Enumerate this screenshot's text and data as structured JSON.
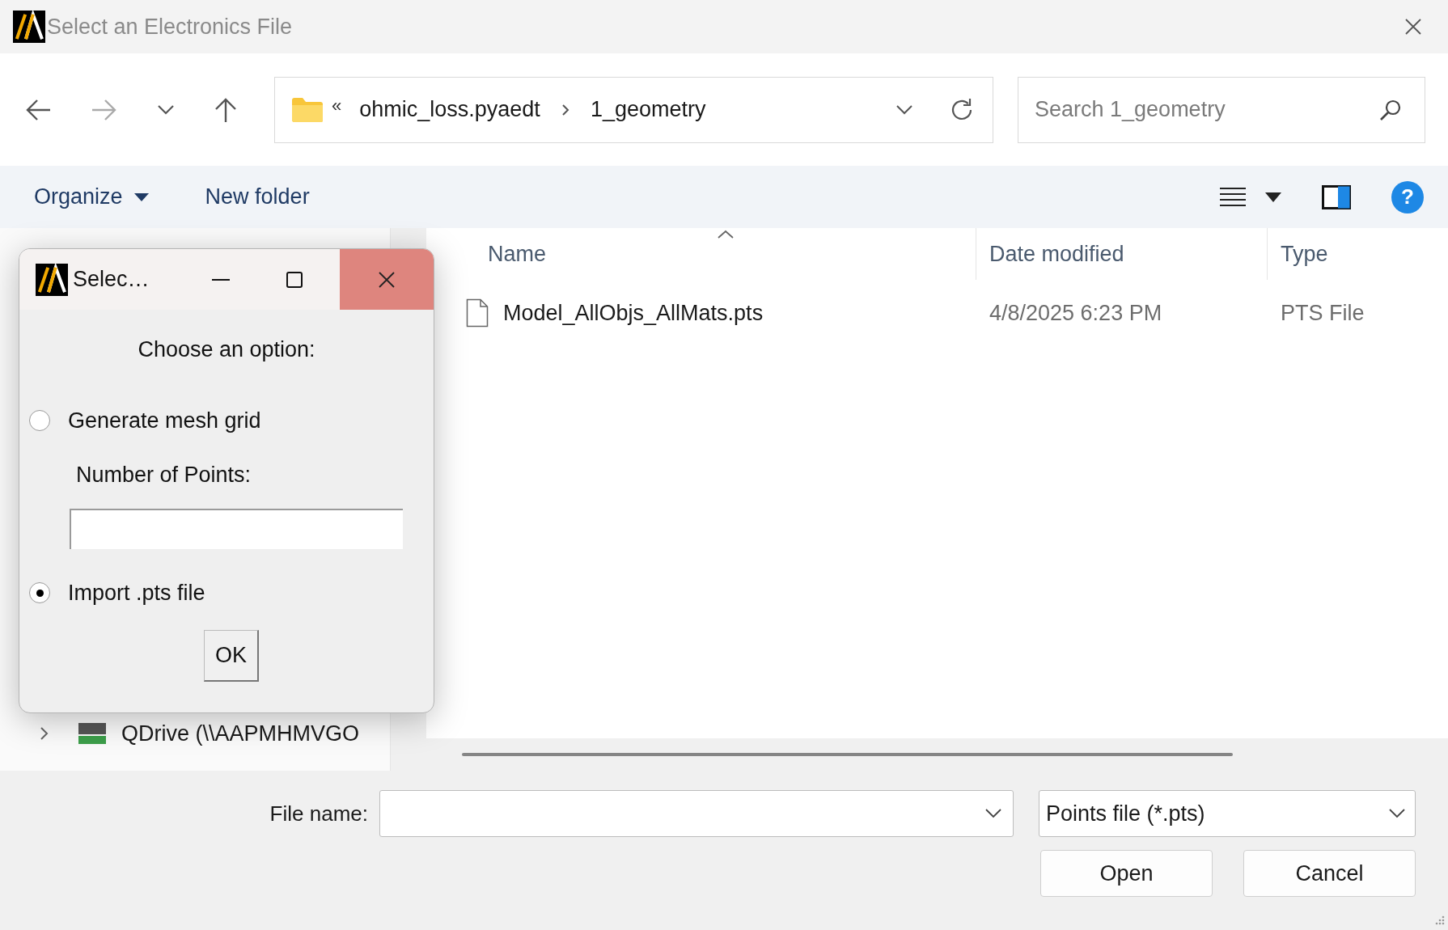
{
  "window": {
    "title": "Select an Electronics File"
  },
  "nav": {
    "path_prefix": "«",
    "path": [
      "ohmic_loss.pyaedt",
      "1_geometry"
    ],
    "search": {
      "placeholder": "Search 1_geometry"
    }
  },
  "toolbar": {
    "organize": "Organize",
    "new_folder": "New folder",
    "help": "?"
  },
  "sidebar": {
    "items": [
      {
        "label": "QDrive (\\\\AAPMHMVGO",
        "expanded": false
      }
    ]
  },
  "table": {
    "columns": [
      {
        "label": "Name",
        "sorted": true
      },
      {
        "label": "Date modified",
        "sorted": false
      },
      {
        "label": "Type",
        "sorted": false
      }
    ],
    "rows": [
      {
        "name": "Model_AllObjs_AllMats.pts",
        "date": "4/8/2025 6:23 PM",
        "type": "PTS File"
      }
    ]
  },
  "footer": {
    "file_name_label": "File name:",
    "filter": "Points file (*.pts)",
    "buttons": [
      "Open",
      "Cancel"
    ]
  },
  "dialog": {
    "title": "Selec…",
    "prompt": "Choose an option:",
    "options": [
      {
        "label": "Generate mesh grid",
        "selected": false
      },
      {
        "label": "Import .pts file",
        "selected": true
      }
    ],
    "points_label": "Number of Points:",
    "ok": "OK"
  }
}
